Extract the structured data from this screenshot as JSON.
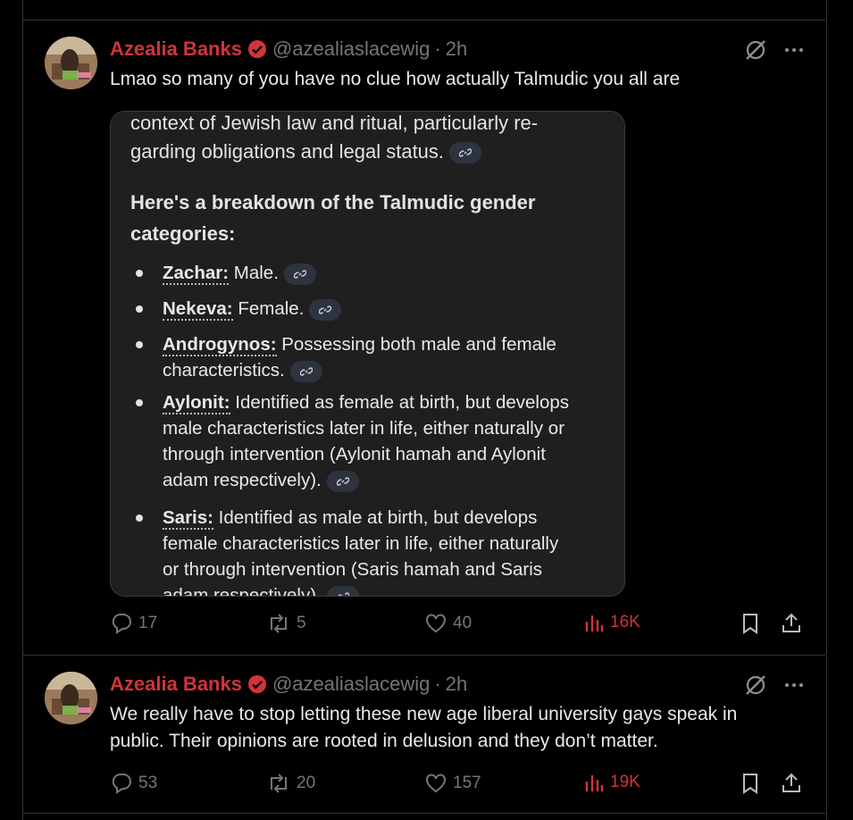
{
  "tweets": [
    {
      "author": "Azealia Banks",
      "handle": "@azealiaslacewig",
      "separator": "·",
      "time": "2h",
      "text": "Lmao so many of you have no clue how actually Talmudic you all are",
      "media": {
        "top_lines": [
          "context of Jewish law and ritual, particularly re-",
          "garding obligations and legal status."
        ],
        "heading_lines": [
          "Here's a breakdown of the Talmudic gender",
          "categories:"
        ],
        "items": [
          {
            "term": "Zachar:",
            "lines": [
              " Male."
            ]
          },
          {
            "term": "Nekeva:",
            "lines": [
              " Female."
            ]
          },
          {
            "term": "Androgynos:",
            "lines": [
              " Possessing both male and female",
              "characteristics."
            ]
          },
          {
            "term": "Aylonit:",
            "lines": [
              " Identified as female at birth, but develops",
              "male characteristics later in life, either naturally or",
              "through intervention (Aylonit hamah and Aylonit",
              "adam respectively)."
            ]
          },
          {
            "term": "Saris:",
            "lines": [
              " Identified as male at birth, but develops",
              "female characteristics later in life, either naturally",
              "or through intervention (Saris hamah and Saris",
              "adam respectively)."
            ]
          }
        ]
      },
      "stats": {
        "replies": "17",
        "reposts": "5",
        "likes": "40",
        "views": "16K"
      }
    },
    {
      "author": "Azealia Banks",
      "handle": "@azealiaslacewig",
      "separator": "·",
      "time": "2h",
      "text_lines": [
        "We really have to stop letting these new age liberal university gays speak in",
        "public. Their opinions are rooted in delusion and they don’t matter."
      ],
      "stats": {
        "replies": "53",
        "reposts": "20",
        "likes": "157",
        "views": "19K"
      }
    }
  ],
  "colors": {
    "name": "#d0343a",
    "muted": "#71767b",
    "background": "#000000",
    "border": "#2f3336"
  },
  "icons": [
    "verified-badge-icon",
    "grok-icon",
    "more-icon",
    "reply-icon",
    "repost-icon",
    "like-icon",
    "views-icon",
    "bookmark-icon",
    "share-icon",
    "link-icon"
  ]
}
